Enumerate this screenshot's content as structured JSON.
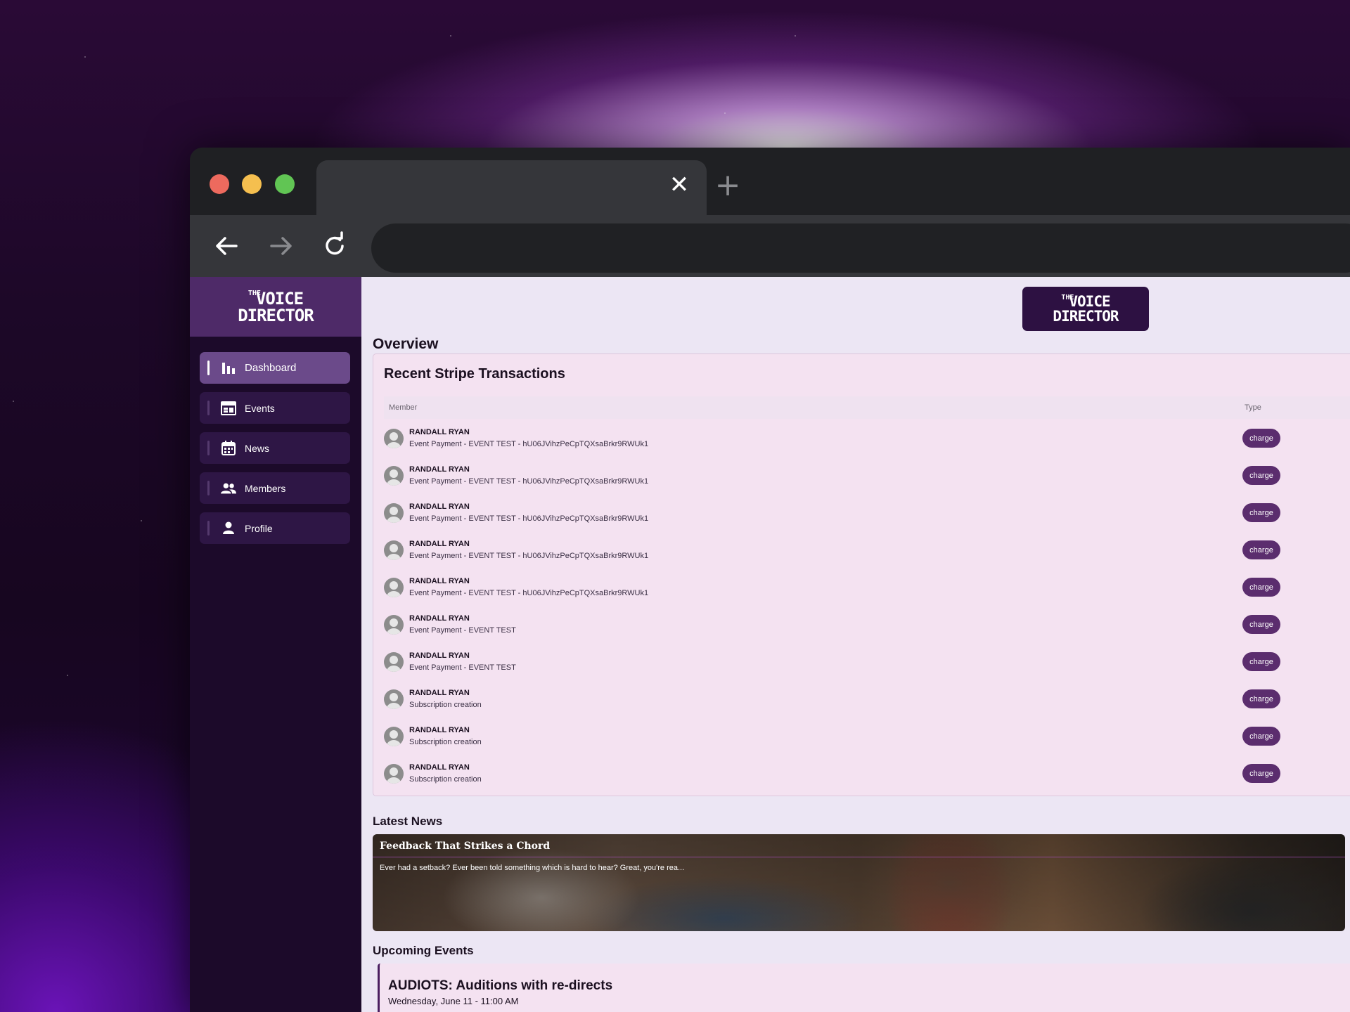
{
  "browser": {
    "tab_close_glyph": "✕",
    "tab_add_glyph": "+",
    "icons": [
      "back-arrow-icon",
      "forward-arrow-icon",
      "reload-icon"
    ]
  },
  "brand": {
    "logo_the": "THE",
    "logo_line1": "VOICE",
    "logo_line2": "DIRECTOR",
    "colors": {
      "sidebar": "#1c0a2a",
      "logo_bg": "#4e2a68",
      "accent": "#5b2d6e",
      "card": "#f4e2f1",
      "page": "#ece6f4"
    }
  },
  "sidebar": {
    "items": [
      {
        "label": "Dashboard",
        "icon": "bar-chart-icon",
        "active": true
      },
      {
        "label": "Events",
        "icon": "calendar-table-icon",
        "active": false
      },
      {
        "label": "News",
        "icon": "calendar-icon",
        "active": false
      },
      {
        "label": "Members",
        "icon": "users-icon",
        "active": false
      },
      {
        "label": "Profile",
        "icon": "user-icon",
        "active": false
      }
    ]
  },
  "main": {
    "overview_title": "Overview",
    "transactions": {
      "title": "Recent Stripe Transactions",
      "columns": {
        "member": "Member",
        "type": "Type"
      },
      "rows": [
        {
          "name": "RANDALL RYAN",
          "description": "Event Payment - EVENT TEST - hU06JVihzPeCpTQXsaBrkr9RWUk1",
          "type": "charge"
        },
        {
          "name": "RANDALL RYAN",
          "description": "Event Payment - EVENT TEST - hU06JVihzPeCpTQXsaBrkr9RWUk1",
          "type": "charge"
        },
        {
          "name": "RANDALL RYAN",
          "description": "Event Payment - EVENT TEST - hU06JVihzPeCpTQXsaBrkr9RWUk1",
          "type": "charge"
        },
        {
          "name": "RANDALL RYAN",
          "description": "Event Payment - EVENT TEST - hU06JVihzPeCpTQXsaBrkr9RWUk1",
          "type": "charge"
        },
        {
          "name": "RANDALL RYAN",
          "description": "Event Payment - EVENT TEST - hU06JVihzPeCpTQXsaBrkr9RWUk1",
          "type": "charge"
        },
        {
          "name": "RANDALL RYAN",
          "description": "Event Payment - EVENT TEST",
          "type": "charge"
        },
        {
          "name": "RANDALL RYAN",
          "description": "Event Payment - EVENT TEST",
          "type": "charge"
        },
        {
          "name": "RANDALL RYAN",
          "description": "Subscription creation",
          "type": "charge"
        },
        {
          "name": "RANDALL RYAN",
          "description": "Subscription creation",
          "type": "charge"
        },
        {
          "name": "RANDALL RYAN",
          "description": "Subscription creation",
          "type": "charge"
        }
      ]
    },
    "latest_news": {
      "title": "Latest News",
      "item": {
        "headline": "Feedback That Strikes a Chord",
        "excerpt": "Ever had a setback? Ever been told something which is hard to hear? Great, you're rea..."
      }
    },
    "upcoming_events": {
      "title": "Upcoming Events",
      "item": {
        "name": "AUDIOTS: Auditions with re-directs",
        "date": "Wednesday, June 11 - 11:00 AM"
      }
    }
  }
}
